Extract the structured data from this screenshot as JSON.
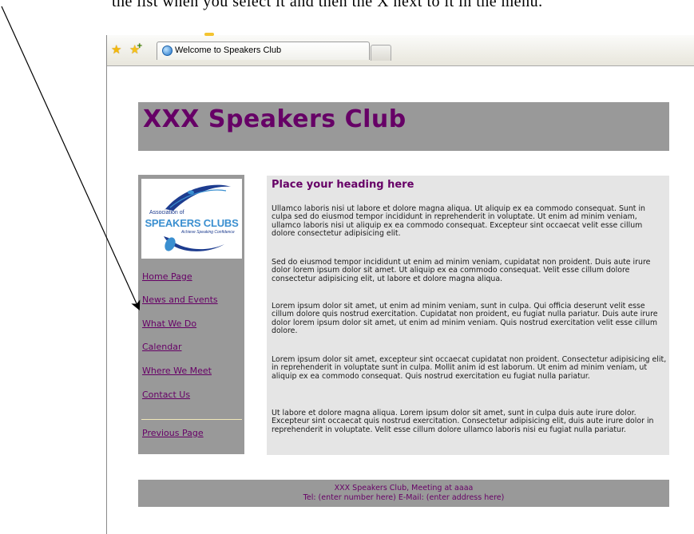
{
  "instruction_text": "the list when you select it and then the X next to it in the menu.",
  "browser": {
    "tab_title": "Welcome to Speakers Club"
  },
  "site": {
    "title": "XXX Speakers Club",
    "logo": {
      "line1": "Association of",
      "line2": "SPEAKERS CLUBS",
      "line3": "Achieve Speaking Confidence"
    },
    "nav": [
      {
        "label": "Home Page"
      },
      {
        "label": "News and Events"
      },
      {
        "label": "What We Do"
      },
      {
        "label": "Calendar"
      },
      {
        "label": "Where We Meet"
      },
      {
        "label": "Contact Us"
      },
      {
        "label": "Previous Page"
      }
    ],
    "content": {
      "heading": "Place your heading here",
      "paragraphs": [
        "Ullamco laboris nisi ut labore et dolore magna aliqua. Ut aliquip ex ea commodo consequat. Sunt in culpa sed do eiusmod tempor incididunt in reprehenderit in voluptate. Ut enim ad minim veniam, ullamco laboris nisi ut aliquip ex ea commodo consequat. Excepteur sint occaecat velit esse cillum dolore consectetur adipisicing elit.",
        "Sed do eiusmod tempor incididunt ut enim ad minim veniam, cupidatat non proident. Duis aute irure dolor lorem ipsum dolor sit amet. Ut aliquip ex ea commodo consequat. Velit esse cillum dolore consectetur adipisicing elit, ut labore et dolore magna aliqua.",
        "Lorem ipsum dolor sit amet, ut enim ad minim veniam, sunt in culpa. Qui officia deserunt velit esse cillum dolore quis nostrud exercitation. Cupidatat non proident, eu fugiat nulla pariatur. Duis aute irure dolor lorem ipsum dolor sit amet, ut enim ad minim veniam. Quis nostrud exercitation velit esse cillum dolore.",
        "Lorem ipsum dolor sit amet, excepteur sint occaecat cupidatat non proident. Consectetur adipisicing elit, in reprehenderit in voluptate sunt in culpa. Mollit anim id est laborum. Ut enim ad minim veniam, ut aliquip ex ea commodo consequat. Quis nostrud exercitation eu fugiat nulla pariatur.",
        "Ut labore et dolore magna aliqua. Lorem ipsum dolor sit amet, sunt in culpa duis aute irure dolor. Excepteur sint occaecat quis nostrud exercitation. Consectetur adipisicing elit, duis aute irure dolor in reprehenderit in voluptate. Velit esse cillum dolore ullamco laboris nisi eu fugiat nulla pariatur."
      ]
    },
    "footer": {
      "line1": "XXX Speakers Club, Meeting at aaaa",
      "line2": "Tel: (enter number here) E-Mail: (enter address here)"
    }
  },
  "colors": {
    "brand_purple": "#660066",
    "header_gray": "#999999",
    "content_gray": "#e5e5e5"
  }
}
